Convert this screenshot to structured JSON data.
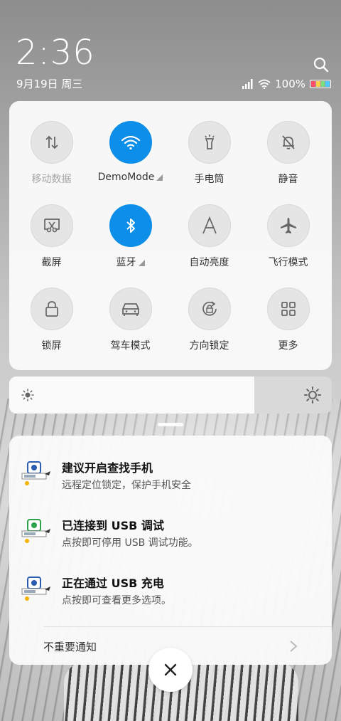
{
  "header": {
    "time": "2:36",
    "date": "9月19日 周三",
    "battery_percent": "100%"
  },
  "colors": {
    "accent": "#0d8ee8",
    "battery_segments": [
      "#ff4f6a",
      "#ffd24a",
      "#7be07b",
      "#4fc8ff"
    ]
  },
  "toggles": [
    {
      "label": "移动数据",
      "icon": "mobile-data-icon",
      "active": false,
      "dim": true,
      "caret": false
    },
    {
      "label": "DemoMode",
      "icon": "wifi-icon",
      "active": true,
      "dim": false,
      "caret": true
    },
    {
      "label": "手电筒",
      "icon": "flashlight-icon",
      "active": false,
      "dim": false,
      "caret": false
    },
    {
      "label": "静音",
      "icon": "bell-off-icon",
      "active": false,
      "dim": false,
      "caret": false
    },
    {
      "label": "截屏",
      "icon": "screenshot-icon",
      "active": false,
      "dim": false,
      "caret": false
    },
    {
      "label": "蓝牙",
      "icon": "bluetooth-icon",
      "active": true,
      "dim": false,
      "caret": true
    },
    {
      "label": "自动亮度",
      "icon": "auto-brightness-icon",
      "active": false,
      "dim": false,
      "caret": false
    },
    {
      "label": "飞行模式",
      "icon": "airplane-icon",
      "active": false,
      "dim": false,
      "caret": false
    },
    {
      "label": "锁屏",
      "icon": "lock-icon",
      "active": false,
      "dim": false,
      "caret": false
    },
    {
      "label": "驾车模式",
      "icon": "car-icon",
      "active": false,
      "dim": false,
      "caret": false
    },
    {
      "label": "方向锁定",
      "icon": "rotation-lock-icon",
      "active": false,
      "dim": false,
      "caret": false
    },
    {
      "label": "更多",
      "icon": "grid-icon",
      "active": false,
      "dim": false,
      "caret": false
    }
  ],
  "brightness": {
    "level": 0.76
  },
  "notifications": [
    {
      "title": "建议开启查找手机",
      "body": "远程定位锁定，保护手机安全",
      "icon": "find-phone-icon"
    },
    {
      "title": "已连接到 USB 调试",
      "body": "点按即可停用 USB 调试功能。",
      "icon": "usb-debug-icon"
    },
    {
      "title": "正在通过 USB 充电",
      "body": "点按即可查看更多选项。",
      "icon": "usb-charging-icon"
    }
  ],
  "unimportant": {
    "label": "不重要通知"
  }
}
